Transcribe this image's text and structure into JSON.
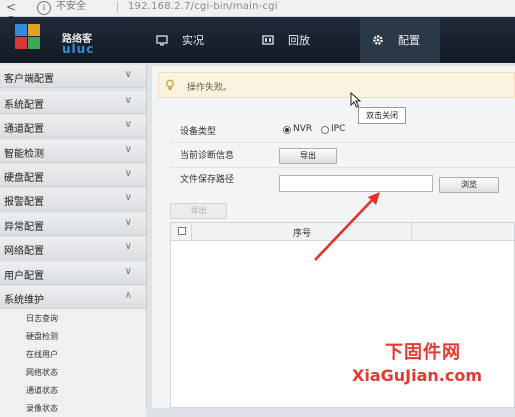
{
  "browser": {
    "nav": [
      "<",
      "C"
    ],
    "security": "不安全",
    "url": "192.168.2.7/cgi-bin/main-cgi"
  },
  "app": {
    "logo_name": "路络客",
    "logo_text": "uluc"
  },
  "topnav": [
    {
      "label": "实况",
      "icon": "monitor-icon"
    },
    {
      "label": "回放",
      "icon": "film-icon"
    },
    {
      "label": "配置",
      "icon": "gear-icon",
      "active": true
    }
  ],
  "sidebar": {
    "items": [
      {
        "label": "客户端配置",
        "chevron": "down"
      },
      {
        "label": "系统配置",
        "chevron": "down"
      },
      {
        "label": "通道配置",
        "chevron": "down"
      },
      {
        "label": "智能检测",
        "chevron": "down"
      },
      {
        "label": "硬盘配置",
        "chevron": "down"
      },
      {
        "label": "报警配置",
        "chevron": "down"
      },
      {
        "label": "异常配置",
        "chevron": "down"
      },
      {
        "label": "网络配置",
        "chevron": "down"
      },
      {
        "label": "用户配置",
        "chevron": "down"
      },
      {
        "label": "系统维护",
        "chevron": "up"
      }
    ],
    "subitems": [
      "日志查询",
      "硬盘检测",
      "在线用户",
      "网络状态",
      "通道状态",
      "录像状态"
    ]
  },
  "alert": {
    "message": "操作失败。",
    "tooltip": "双击关闭"
  },
  "form": {
    "device_type_label": "设备类型",
    "device_type_options": [
      "NVR",
      "IPC"
    ],
    "device_type_selected": "NVR",
    "diag_info_label": "当前诊断信息",
    "export_button": "导出",
    "save_path_label": "文件保存路径",
    "save_path_value": "",
    "browse_button": "浏览"
  },
  "table": {
    "export_button": "导出",
    "columns": [
      "序号"
    ]
  },
  "watermark": {
    "cn": "下固件网",
    "en": "XiaGuJian.com"
  },
  "colors": {
    "accent": "#2b3848",
    "watermark": "#e33a2f",
    "alert_bg": "#fbf3df"
  }
}
